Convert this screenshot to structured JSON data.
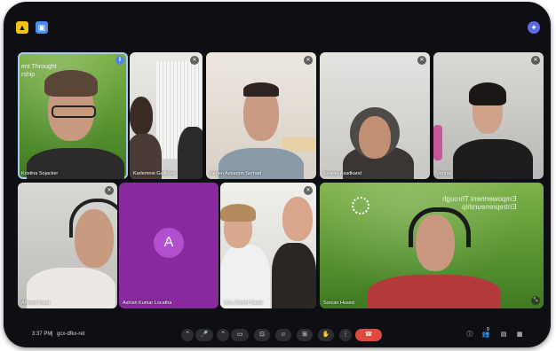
{
  "colors": {
    "frame": "#0e0f12",
    "end_call": "#e0483e",
    "avatar": "#b24fcf",
    "tile_purple": "#8a2a9e",
    "active_outline": "#a9c8f5"
  },
  "meeting": {
    "time": "3:37 PM",
    "divider": "|",
    "code": "gcx-dfkx-ret"
  },
  "tiles": [
    {
      "name": "Kristina Sojacker",
      "overlay": "ent Throught\nrship"
    },
    {
      "name": "Karlemnie Gaillever"
    },
    {
      "name": "Serjen Asbarjon Serhad"
    },
    {
      "name": "Serkan Asadkand"
    },
    {
      "name": "Joonar"
    },
    {
      "name": "Ahmed Tonal"
    },
    {
      "name": "Ashish Kumar Locatha",
      "avatar_letter": "A"
    },
    {
      "name": "Lina Jovent Sarial"
    },
    {
      "name": "Sorcan Hused",
      "overlay": "Empowerment Through\nEntrepreneurship"
    }
  ],
  "controls": [
    {
      "icon": "chevron-up-icon",
      "glyph": "⌃"
    },
    {
      "icon": "mic-icon",
      "glyph": "🎤"
    },
    {
      "icon": "chevron-up-icon",
      "glyph": "⌃"
    },
    {
      "icon": "camera-icon",
      "glyph": "▭"
    },
    {
      "icon": "captions-icon",
      "glyph": "⊡"
    },
    {
      "icon": "emoji-icon",
      "glyph": "☺"
    },
    {
      "icon": "present-icon",
      "glyph": "⊞"
    },
    {
      "icon": "raise-hand-icon",
      "glyph": "✋"
    },
    {
      "icon": "more-icon",
      "glyph": "⋮"
    },
    {
      "icon": "end-call-icon",
      "glyph": "☎"
    }
  ],
  "right_controls": [
    {
      "icon": "info-icon",
      "glyph": "ⓘ"
    },
    {
      "icon": "people-icon",
      "glyph": "👥",
      "badge": "9"
    },
    {
      "icon": "chat-icon",
      "glyph": "▤"
    },
    {
      "icon": "activities-icon",
      "glyph": "▦"
    }
  ]
}
